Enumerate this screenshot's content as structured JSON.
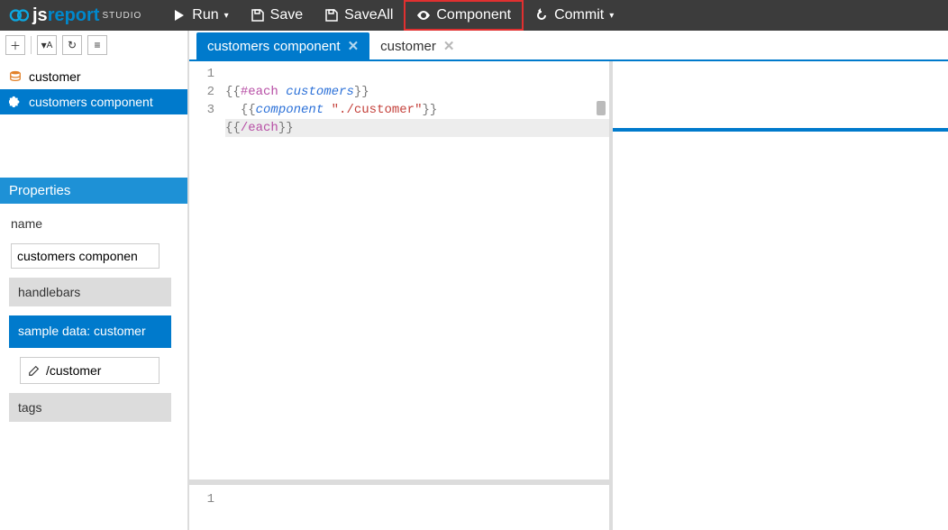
{
  "logo": {
    "prefix": "js",
    "main": "report",
    "suffix": "STUDIO"
  },
  "toolbar": {
    "run": "Run",
    "save": "Save",
    "saveAll": "SaveAll",
    "component": "Component",
    "commit": "Commit"
  },
  "tree": {
    "items": [
      {
        "label": "customer",
        "type": "data"
      },
      {
        "label": "customers component",
        "type": "component",
        "active": true
      }
    ]
  },
  "properties": {
    "header": "Properties",
    "nameLabel": "name",
    "nameValue": "customers componen",
    "engine": "handlebars",
    "sampleDataHeader": "sample data: customer",
    "sampleDataValue": "/customer",
    "tags": "tags"
  },
  "tabs": [
    {
      "label": "customers component",
      "active": true
    },
    {
      "label": "customer",
      "active": false
    }
  ],
  "editor": {
    "lines": [
      "1",
      "2",
      "3"
    ],
    "code": {
      "l1": {
        "open": "{{",
        "kw": "#each",
        "ident": "customers",
        "close": "}}"
      },
      "l2": {
        "open": "{{",
        "fn": "component",
        "str": "\"./customer\"",
        "close": "}}"
      },
      "l3": {
        "open": "{{",
        "kw": "/each",
        "close": "}}"
      }
    }
  },
  "bottomEditor": {
    "lines": [
      "1"
    ]
  }
}
